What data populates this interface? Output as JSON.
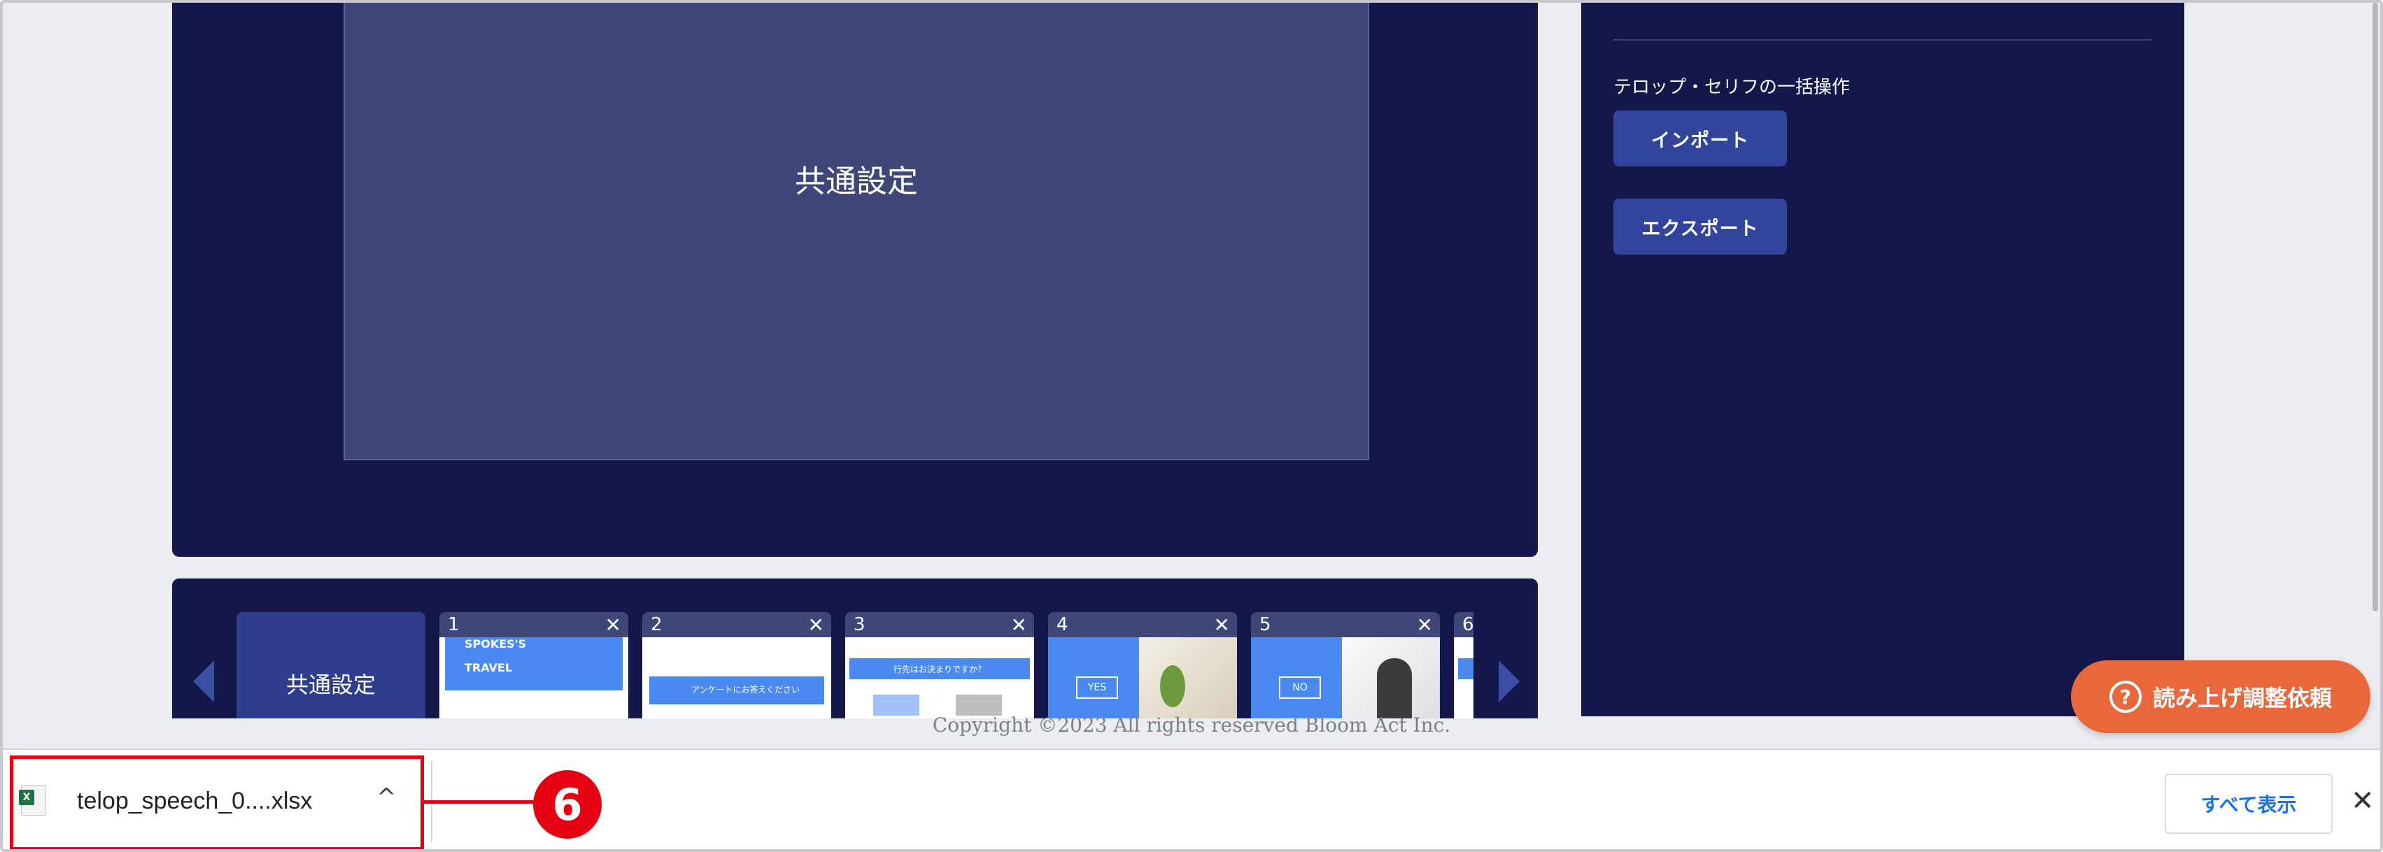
{
  "preview": {
    "title": "共通設定"
  },
  "settings": {
    "bulk_label": "テロップ・セリフの一括操作",
    "import_label": "インポート",
    "export_label": "エクスポート"
  },
  "strip": {
    "common_label": "共通設定",
    "thumbnails": [
      {
        "number": "1",
        "close": "✕",
        "text_a": "SPOKES'S",
        "text_b": "TRAVEL"
      },
      {
        "number": "2",
        "close": "✕",
        "text_a": "アンケートにお答えください"
      },
      {
        "number": "3",
        "close": "✕",
        "text_a": "行先はお決まりですか？"
      },
      {
        "number": "4",
        "close": "✕",
        "badge": "YES"
      },
      {
        "number": "5",
        "close": "✕",
        "badge": "NO"
      },
      {
        "number": "6"
      }
    ]
  },
  "footer": {
    "copyright": "Copyright ©2023 All rights reserved Bloom Act Inc."
  },
  "fab": {
    "icon": "?",
    "label": "読み上げ調整依頼"
  },
  "download_bar": {
    "file_name": "telop_speech_0....xlsx",
    "file_icon": "excel-icon",
    "chevron": "^",
    "show_all": "すべて表示",
    "close": "✕"
  },
  "callout": {
    "number": "6",
    "color": "#e60012"
  },
  "colors": {
    "panel": "#13174a",
    "accent_button": "#33449c",
    "fab": "#e8683c",
    "thumb_blue": "#4a8af0"
  }
}
